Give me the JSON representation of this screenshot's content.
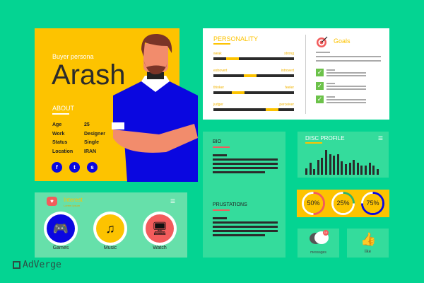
{
  "persona": {
    "subtitle": "Buyer persona",
    "name": "Arash",
    "about_title": "ABOUT",
    "about": [
      {
        "k": "Age",
        "v": "25"
      },
      {
        "k": "Work",
        "v": "Designer"
      },
      {
        "k": "Status",
        "v": "Single"
      },
      {
        "k": "Location",
        "v": "IRAN"
      }
    ],
    "social": [
      "facebook-icon",
      "twitter-icon",
      "skype-icon"
    ]
  },
  "personality": {
    "title": "PERSONALITY",
    "traits": [
      {
        "left": "weak",
        "right": "strong",
        "value": 0.24
      },
      {
        "left": "extrovert",
        "right": "introvert",
        "value": 0.46
      },
      {
        "left": "thinker",
        "right": "feeler",
        "value": 0.31
      },
      {
        "left": "judger",
        "right": "perceiver",
        "value": 0.73
      }
    ]
  },
  "goals": {
    "title": "Goals",
    "icon": "target-icon",
    "checked_items": 3
  },
  "bio": {
    "title": "BIO"
  },
  "frustrations": {
    "title": "PRUSTATIONS"
  },
  "disc": {
    "title": "DISC PROFILE",
    "bars": [
      25,
      50,
      22,
      60,
      68,
      100,
      82,
      78,
      82,
      55,
      42,
      50,
      60,
      50,
      36,
      36,
      50,
      36,
      22
    ]
  },
  "rings": [
    {
      "label": "50%",
      "value": 50,
      "color": "#f25c5c"
    },
    {
      "label": "25%",
      "value": 25,
      "color": "#2fb36b"
    },
    {
      "label": "75%",
      "value": 75,
      "color": "#0a07e0"
    }
  ],
  "social_stats": {
    "messages_label": "messages",
    "messages_badge": "10",
    "like_label": "like"
  },
  "interest": {
    "title": "Interest",
    "subtitle": "Lorem ipsum",
    "items": [
      {
        "label": "Games",
        "color": "#0a07e0",
        "icon": "gamepad-icon"
      },
      {
        "label": "Music",
        "color": "#fdc300",
        "icon": "music-icon"
      },
      {
        "label": "Watch",
        "color": "#f25c5c",
        "icon": "monitor-icon"
      }
    ]
  },
  "logo": {
    "text": "AdVerge"
  },
  "colors": {
    "bg": "#04d492",
    "yellow": "#fdc300",
    "blue": "#0a07e0",
    "red": "#f25c5c"
  }
}
